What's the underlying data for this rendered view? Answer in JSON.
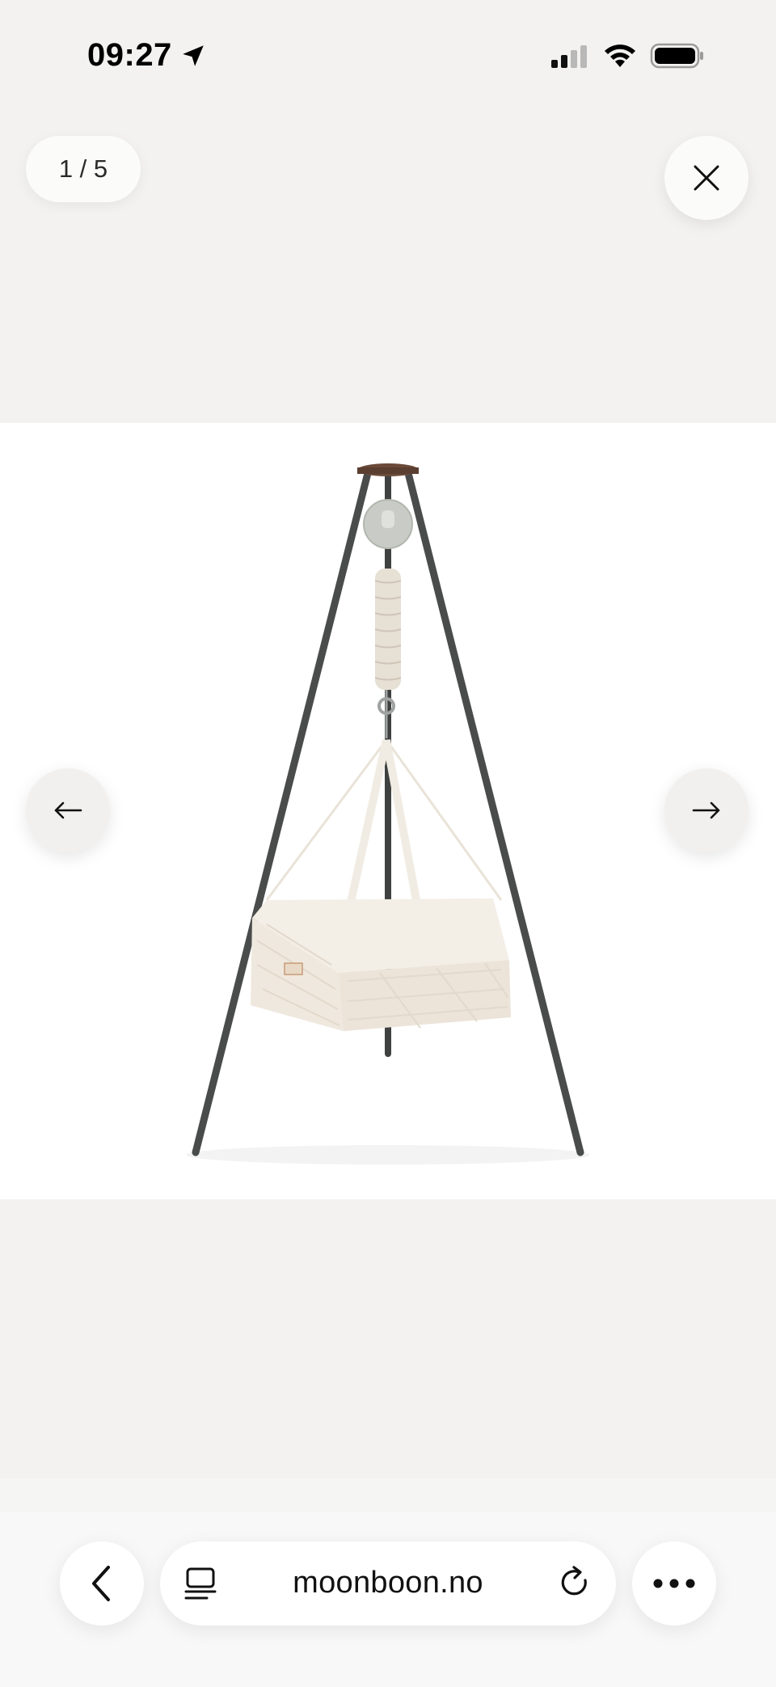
{
  "status": {
    "time": "09:27",
    "icons": [
      "location-arrow-icon",
      "cellular-signal-icon",
      "wifi-icon",
      "battery-icon"
    ]
  },
  "gallery": {
    "counter": "1 / 5",
    "current_index": 1,
    "total": 5,
    "close_icon": "close-icon",
    "prev_icon": "arrow-left-icon",
    "next_icon": "arrow-right-icon",
    "image_subject": "hanging cradle on tripod stand"
  },
  "browser": {
    "url": "moonboon.no",
    "back_icon": "chevron-left-icon",
    "tabs_icon": "page-menu-icon",
    "reload_icon": "reload-icon",
    "more_icon": "more-dots-icon"
  },
  "colors": {
    "background": "#f3f2f1",
    "image_background": "#ffffff",
    "frame": "#4a4c4c",
    "fabric": "#efe8de"
  }
}
